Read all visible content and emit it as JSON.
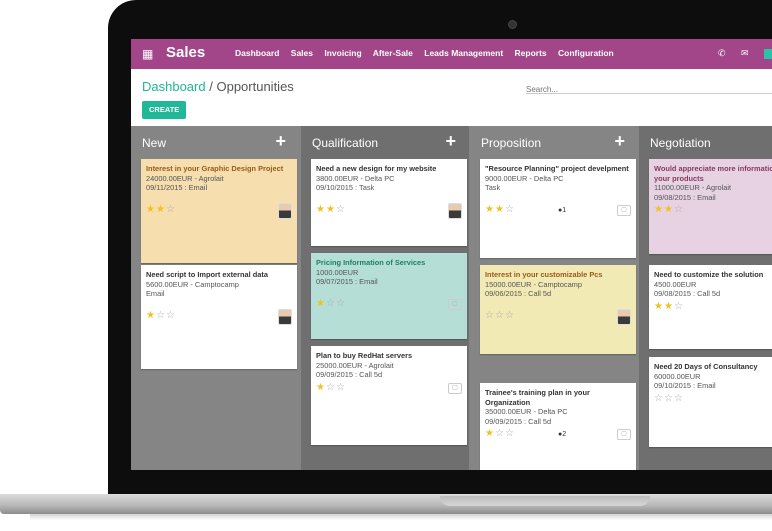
{
  "topbar": {
    "app_title": "Sales",
    "menu": [
      "Dashboard",
      "Sales",
      "Invoicing",
      "After-Sale",
      "Leads Management",
      "Reports",
      "Configuration"
    ],
    "background": "#a24689"
  },
  "breadcrumb": {
    "root": "Dashboard",
    "separator": "/",
    "current": "Opportunities"
  },
  "search": {
    "placeholder": "Search..."
  },
  "create_label": "CREATE",
  "accent": "#21b799",
  "columns": [
    {
      "title": "New",
      "cards": [
        {
          "name": "Interest in your Graphic Design Project",
          "amount": "24000.00EUR - Agrolait",
          "date": "09/11/2015 : Email",
          "rating": 2,
          "color": "#f6deae"
        },
        {
          "name": "Need script to Import external data",
          "amount": "5600.00EUR - Camptocamp",
          "date": "Email",
          "rating": 1,
          "color": "#ffffff"
        }
      ]
    },
    {
      "title": "Qualification",
      "cards": [
        {
          "name": "Need a new design for my website",
          "amount": "3800.00EUR - Delta PC",
          "date": "09/10/2015 : Task",
          "rating": 2,
          "color": "#ffffff"
        },
        {
          "name": "Pricing Information of Services",
          "amount": "1000.00EUR",
          "date": "09/07/2015 : Email",
          "rating": 1,
          "color": "#b5dfd6"
        },
        {
          "name": "Plan to buy RedHat servers",
          "amount": "25000.00EUR - Agrolait",
          "date": "09/09/2015 : Call 5d",
          "rating": 1,
          "color": "#ffffff"
        }
      ]
    },
    {
      "title": "Proposition",
      "cards": [
        {
          "name": "\"Resource Planning\" project develpment",
          "amount": "9000.00EUR - Delta PC",
          "date": "Task",
          "rating": 2,
          "messages": "1",
          "color": "#ffffff"
        },
        {
          "name": "Interest in your customizable Pcs",
          "amount": "15000.00EUR - Camptocamp",
          "date": "09/06/2015 : Call 5d",
          "rating": 0,
          "color": "#f2eab5"
        },
        {
          "name": "Trainee's training plan in your Organization",
          "amount": "35000.00EUR - Delta PC",
          "date": "09/09/2015 : Call 5d",
          "rating": 1,
          "messages": "2",
          "color": "#ffffff"
        }
      ]
    },
    {
      "title": "Negotiation",
      "cards": [
        {
          "name": "Would appreciate more information about your products",
          "amount": "11000.00EUR - Agrolait",
          "date": "09/08/2015 : Email",
          "rating": 2,
          "color": "#e6d2e2"
        },
        {
          "name": "Need to customize the solution",
          "amount": "4500.00EUR",
          "date": "09/08/2015 : Call 5d",
          "rating": 2,
          "color": "#ffffff"
        },
        {
          "name": "Need 20 Days of Consultancy",
          "amount": "60000.00EUR",
          "date": "09/10/2015 : Email",
          "rating": 0,
          "color": "#ffffff"
        }
      ]
    }
  ]
}
